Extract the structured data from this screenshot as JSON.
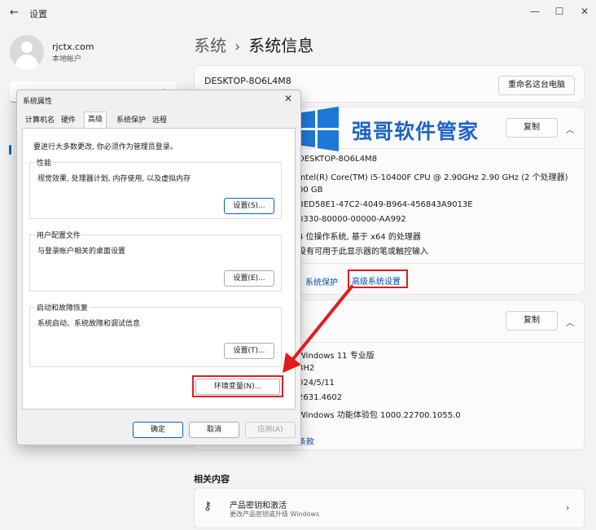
{
  "window": {
    "title": "设置",
    "back": "←",
    "min": "—",
    "max": "☐",
    "close": "✕"
  },
  "account": {
    "name": "rjctx.com",
    "type": "本地帐户"
  },
  "breadcrumb": {
    "parent": "系统",
    "separator": "›",
    "current": "系统信息"
  },
  "device": {
    "name": "DESKTOP-8O6L4M8",
    "rename_label": "重命名这台电脑"
  },
  "specs": {
    "copy_label": "复制",
    "values": [
      "DESKTOP-8O6L4M8",
      "Intel(R) Core(TM) i5-10400F CPU @ 2.90GHz   2.90 GHz  (2 个处理器)",
      "00 GB",
      "BED58E1-47C2-4049-B964-456843A9013E",
      "0330-80000-00000-AA992",
      "4 位操作系统, 基于 x64 的处理器",
      "没有可用于此显示器的笔或触控输入"
    ],
    "links": {
      "protection": "系统保护",
      "advanced": "高级系统设置"
    }
  },
  "windows_spec": {
    "copy_label": "复制",
    "values": [
      "Windows 11 专业版",
      "3H2",
      "024/5/11",
      "2631.4602",
      "Windows 功能体验包 1000.22700.1055.0"
    ],
    "terms_link": "条款"
  },
  "related": {
    "heading": "相关内容",
    "product_key_title": "产品密钥和激活",
    "product_key_sub": "更改产品密钥或升级 Windows"
  },
  "watermark": {
    "text": "强哥软件管家"
  },
  "dialog": {
    "title": "系统属性",
    "close": "✕",
    "tabs": [
      "计算机名",
      "硬件",
      "高级",
      "系统保护",
      "远程"
    ],
    "admin_note": "要进行大多数更改, 你必须作为管理员登录。",
    "performance": {
      "title": "性能",
      "desc": "视觉效果, 处理器计划, 内存使用, 以及虚拟内存",
      "button": "设置(S)..."
    },
    "profile": {
      "title": "用户配置文件",
      "desc": "与登录帐户相关的桌面设置",
      "button": "设置(E)..."
    },
    "startup": {
      "title": "启动和故障恢复",
      "desc": "系统启动、系统故障和调试信息",
      "button": "设置(T)..."
    },
    "env_button": "环境变量(N)...",
    "ok": "确定",
    "cancel": "取消",
    "apply": "应用(A)"
  },
  "colors": {
    "accent": "#0067c0",
    "highlight": "#e21c1c",
    "watermark": "#1e64c8"
  }
}
